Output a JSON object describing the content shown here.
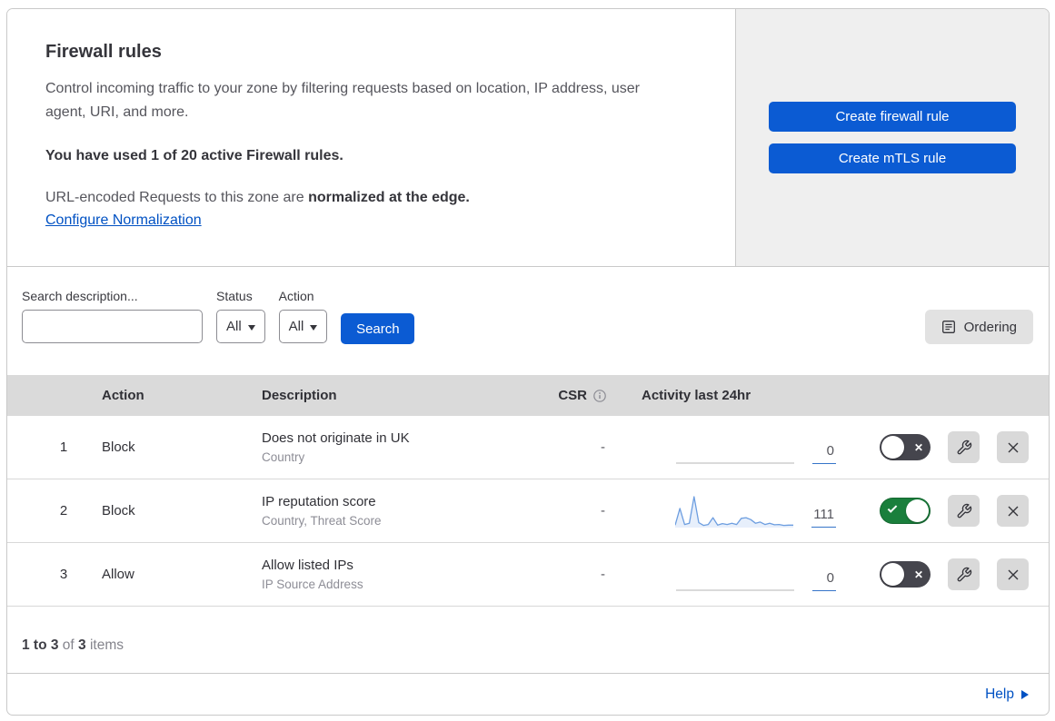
{
  "header": {
    "title": "Firewall rules",
    "description": "Control incoming traffic to your zone by filtering requests based on location, IP address, user agent, URI, and more.",
    "usage_note": "You have used 1 of 20 active Firewall rules.",
    "normalization_prefix": "URL-encoded Requests to this zone are ",
    "normalization_bold": "normalized at the edge.",
    "normalization_link": "Configure Normalization",
    "create_firewall_button": "Create firewall rule",
    "create_mtls_button": "Create mTLS rule"
  },
  "filters": {
    "search_label": "Search description...",
    "search_value": "",
    "status_label": "Status",
    "status_value": "All",
    "action_label": "Action",
    "action_value": "All",
    "search_button": "Search",
    "ordering_button": "Ordering"
  },
  "table": {
    "columns": {
      "action": "Action",
      "description": "Description",
      "csr": "CSR",
      "activity": "Activity last 24hr"
    },
    "rows": [
      {
        "priority": "1",
        "action": "Block",
        "description": "Does not originate in UK",
        "fields": "Country",
        "csr": "-",
        "activity_count": "0",
        "enabled": false
      },
      {
        "priority": "2",
        "action": "Block",
        "description": "IP reputation score",
        "fields": "Country, Threat Score",
        "csr": "-",
        "activity_count": "111",
        "enabled": true
      },
      {
        "priority": "3",
        "action": "Allow",
        "description": "Allow listed IPs",
        "fields": "IP Source Address",
        "csr": "-",
        "activity_count": "0",
        "enabled": false
      }
    ]
  },
  "activity_chart": {
    "type": "area",
    "row_index": 1,
    "normalized_points": [
      0.08,
      0.62,
      0.1,
      0.14,
      1.0,
      0.16,
      0.07,
      0.1,
      0.32,
      0.08,
      0.13,
      0.1,
      0.14,
      0.1,
      0.3,
      0.32,
      0.26,
      0.14,
      0.18,
      0.1,
      0.14,
      0.09,
      0.1,
      0.07,
      0.08,
      0.08
    ],
    "peak_total": "111"
  },
  "footer": {
    "range": "1 to 3",
    "of": " of ",
    "total": "3",
    "items": " items",
    "help": "Help"
  },
  "colors": {
    "primary_blue": "#0b5bd3",
    "link_blue": "#0051c3",
    "toggle_on_green": "#1a7f3c",
    "toggle_off_gray": "#45454d",
    "header_bg": "#dadada",
    "panel_bg": "#efefef",
    "sparkline_blue": "#6d9ee0"
  }
}
